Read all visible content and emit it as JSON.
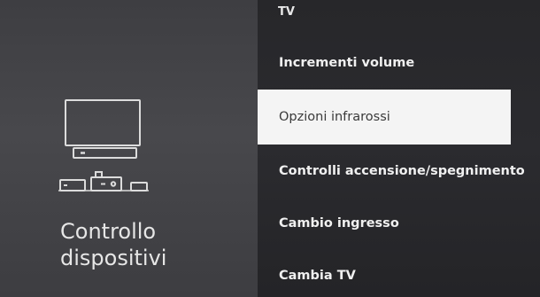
{
  "header": {
    "breadcrumb": "TV"
  },
  "section": {
    "title_line1": "Controllo",
    "title_line2": "dispositivi",
    "icon": "tv-devices-icon"
  },
  "menu": {
    "items": [
      {
        "label": "Incrementi volume",
        "selected": false
      },
      {
        "label": "Opzioni infrarossi",
        "selected": true
      },
      {
        "label": "Controlli accensione/spegnimento",
        "selected": false
      },
      {
        "label": "Cambio ingresso",
        "selected": false
      },
      {
        "label": "Cambia TV",
        "selected": false
      }
    ]
  },
  "colors": {
    "selected_bg": "#f4f4f4",
    "text_light": "#f0f0f0",
    "text_dark": "#3a3a3a"
  }
}
